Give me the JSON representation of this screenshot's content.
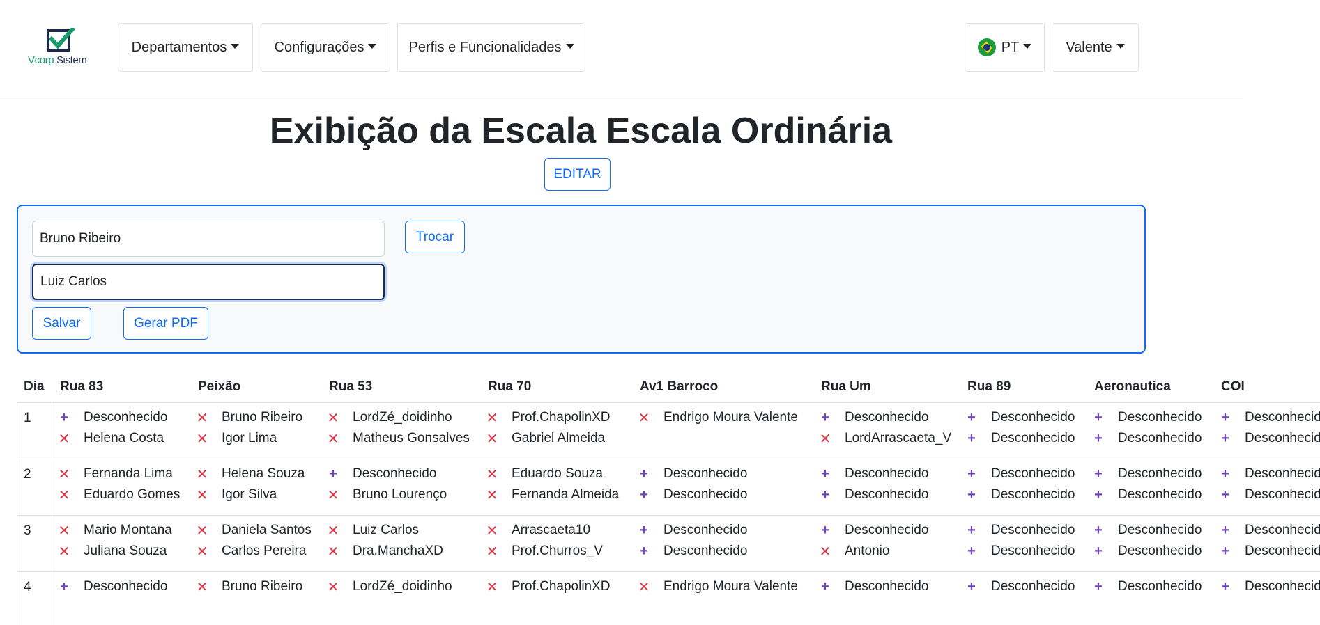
{
  "navbar": {
    "logo_text_v": "Vcorp",
    "logo_text_rest": " Sistem",
    "menus": [
      "Departamentos",
      "Configurações",
      "Perfis e Funcionalidades"
    ],
    "language": "PT",
    "user": "Valente"
  },
  "main": {
    "title": "Exibição da Escala Escala Ordinária",
    "edit_label": "EDITAR"
  },
  "swap_panel": {
    "person_one": "Bruno Ribeiro",
    "person_two": "Luiz Carlos",
    "swap_label": "Trocar",
    "save_label": "Salvar",
    "pdf_label": "Gerar PDF"
  },
  "schedule": {
    "columns": [
      "Dia",
      "Rua 83",
      "Peixão",
      "Rua 53",
      "Rua 70",
      "Av1 Barroco",
      "Rua Um",
      "Rua 89",
      "Aeronautica",
      "COI"
    ],
    "rows": [
      {
        "day": "1",
        "cells": [
          [
            [
              "plus",
              "Desconhecido"
            ],
            [
              "x",
              "Helena Costa"
            ]
          ],
          [
            [
              "x",
              "Bruno Ribeiro"
            ],
            [
              "x",
              "Igor Lima"
            ]
          ],
          [
            [
              "x",
              "LordZé_doidinho"
            ],
            [
              "x",
              "Matheus Gonsalves"
            ]
          ],
          [
            [
              "x",
              "Prof.ChapolinXD"
            ],
            [
              "x",
              "Gabriel Almeida"
            ]
          ],
          [
            [
              "x",
              "Endrigo Moura Valente"
            ]
          ],
          [
            [
              "plus",
              "Desconhecido"
            ],
            [
              "x",
              "LordArrascaeta_V"
            ]
          ],
          [
            [
              "plus",
              "Desconhecido"
            ],
            [
              "plus",
              "Desconhecido"
            ]
          ],
          [
            [
              "plus",
              "Desconhecido"
            ],
            [
              "plus",
              "Desconhecido"
            ]
          ],
          [
            [
              "plus",
              "Desconhecido"
            ],
            [
              "plus",
              "Desconhecido"
            ]
          ]
        ]
      },
      {
        "day": "2",
        "cells": [
          [
            [
              "x",
              "Fernanda Lima"
            ],
            [
              "x",
              "Eduardo Gomes"
            ]
          ],
          [
            [
              "x",
              "Helena Souza"
            ],
            [
              "x",
              "Igor Silva"
            ]
          ],
          [
            [
              "plus",
              "Desconhecido"
            ],
            [
              "x",
              "Bruno Lourenço"
            ]
          ],
          [
            [
              "x",
              "Eduardo Souza"
            ],
            [
              "x",
              "Fernanda Almeida"
            ]
          ],
          [
            [
              "plus",
              "Desconhecido"
            ],
            [
              "plus",
              "Desconhecido"
            ]
          ],
          [
            [
              "plus",
              "Desconhecido"
            ],
            [
              "plus",
              "Desconhecido"
            ]
          ],
          [
            [
              "plus",
              "Desconhecido"
            ],
            [
              "plus",
              "Desconhecido"
            ]
          ],
          [
            [
              "plus",
              "Desconhecido"
            ],
            [
              "plus",
              "Desconhecido"
            ]
          ],
          [
            [
              "plus",
              "Desconhecido"
            ],
            [
              "plus",
              "Desconhecido"
            ]
          ]
        ]
      },
      {
        "day": "3",
        "cells": [
          [
            [
              "x",
              "Mario Montana"
            ],
            [
              "x",
              "Juliana Souza"
            ]
          ],
          [
            [
              "x",
              "Daniela Santos"
            ],
            [
              "x",
              "Carlos Pereira"
            ]
          ],
          [
            [
              "x",
              "Luiz Carlos"
            ],
            [
              "x",
              "Dra.ManchaXD"
            ]
          ],
          [
            [
              "x",
              "Arrascaeta10"
            ],
            [
              "x",
              "Prof.Churros_V"
            ]
          ],
          [
            [
              "plus",
              "Desconhecido"
            ],
            [
              "plus",
              "Desconhecido"
            ]
          ],
          [
            [
              "plus",
              "Desconhecido"
            ],
            [
              "x",
              "Antonio"
            ]
          ],
          [
            [
              "plus",
              "Desconhecido"
            ],
            [
              "plus",
              "Desconhecido"
            ]
          ],
          [
            [
              "plus",
              "Desconhecido"
            ],
            [
              "plus",
              "Desconhecido"
            ]
          ],
          [
            [
              "plus",
              "Desconhecido"
            ],
            [
              "plus",
              "Desconhecido"
            ]
          ]
        ]
      },
      {
        "day": "4",
        "cells": [
          [
            [
              "plus",
              "Desconhecido"
            ]
          ],
          [
            [
              "x",
              "Bruno Ribeiro"
            ]
          ],
          [
            [
              "x",
              "LordZé_doidinho"
            ]
          ],
          [
            [
              "x",
              "Prof.ChapolinXD"
            ]
          ],
          [
            [
              "x",
              "Endrigo Moura Valente"
            ]
          ],
          [
            [
              "plus",
              "Desconhecido"
            ]
          ],
          [
            [
              "plus",
              "Desconhecido"
            ]
          ],
          [
            [
              "plus",
              "Desconhecido"
            ]
          ],
          [
            [
              "plus",
              "Desconhecido"
            ]
          ]
        ]
      }
    ]
  },
  "colors": {
    "primary": "#0d6efd",
    "plus": "#6f42c1",
    "remove": "#dc3545"
  }
}
